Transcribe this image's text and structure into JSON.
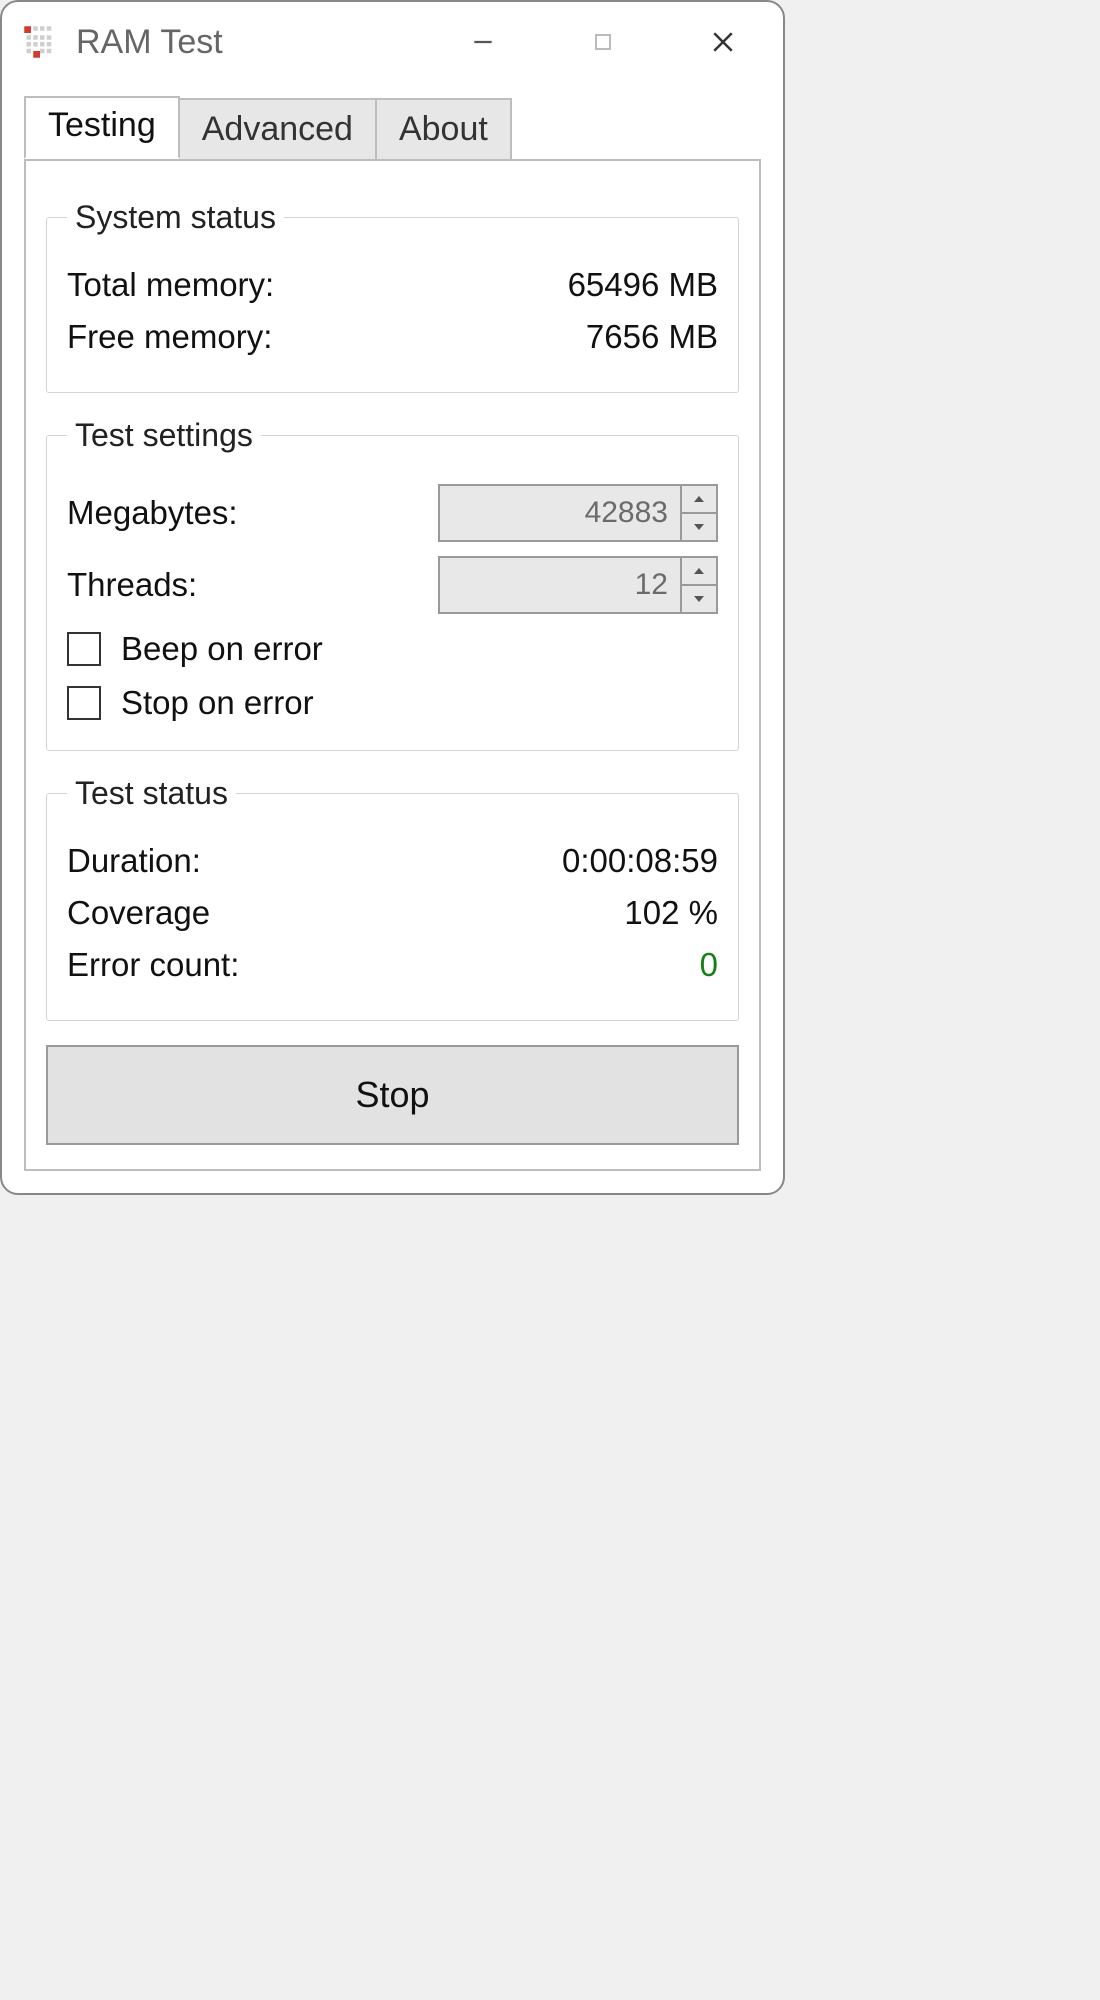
{
  "window": {
    "title": "RAM Test"
  },
  "tabs": {
    "testing": "Testing",
    "advanced": "Advanced",
    "about": "About"
  },
  "system_status": {
    "legend": "System status",
    "total_memory_label": "Total memory:",
    "total_memory_value": "65496 MB",
    "free_memory_label": "Free memory:",
    "free_memory_value": "7656 MB"
  },
  "test_settings": {
    "legend": "Test settings",
    "megabytes_label": "Megabytes:",
    "megabytes_value": "42883",
    "threads_label": "Threads:",
    "threads_value": "12",
    "beep_label": "Beep on error",
    "stop_label": "Stop on error"
  },
  "test_status": {
    "legend": "Test status",
    "duration_label": "Duration:",
    "duration_value": "0:00:08:59",
    "coverage_label": "Coverage",
    "coverage_value": "102 %",
    "error_count_label": "Error count:",
    "error_count_value": "0"
  },
  "buttons": {
    "stop": "Stop"
  }
}
